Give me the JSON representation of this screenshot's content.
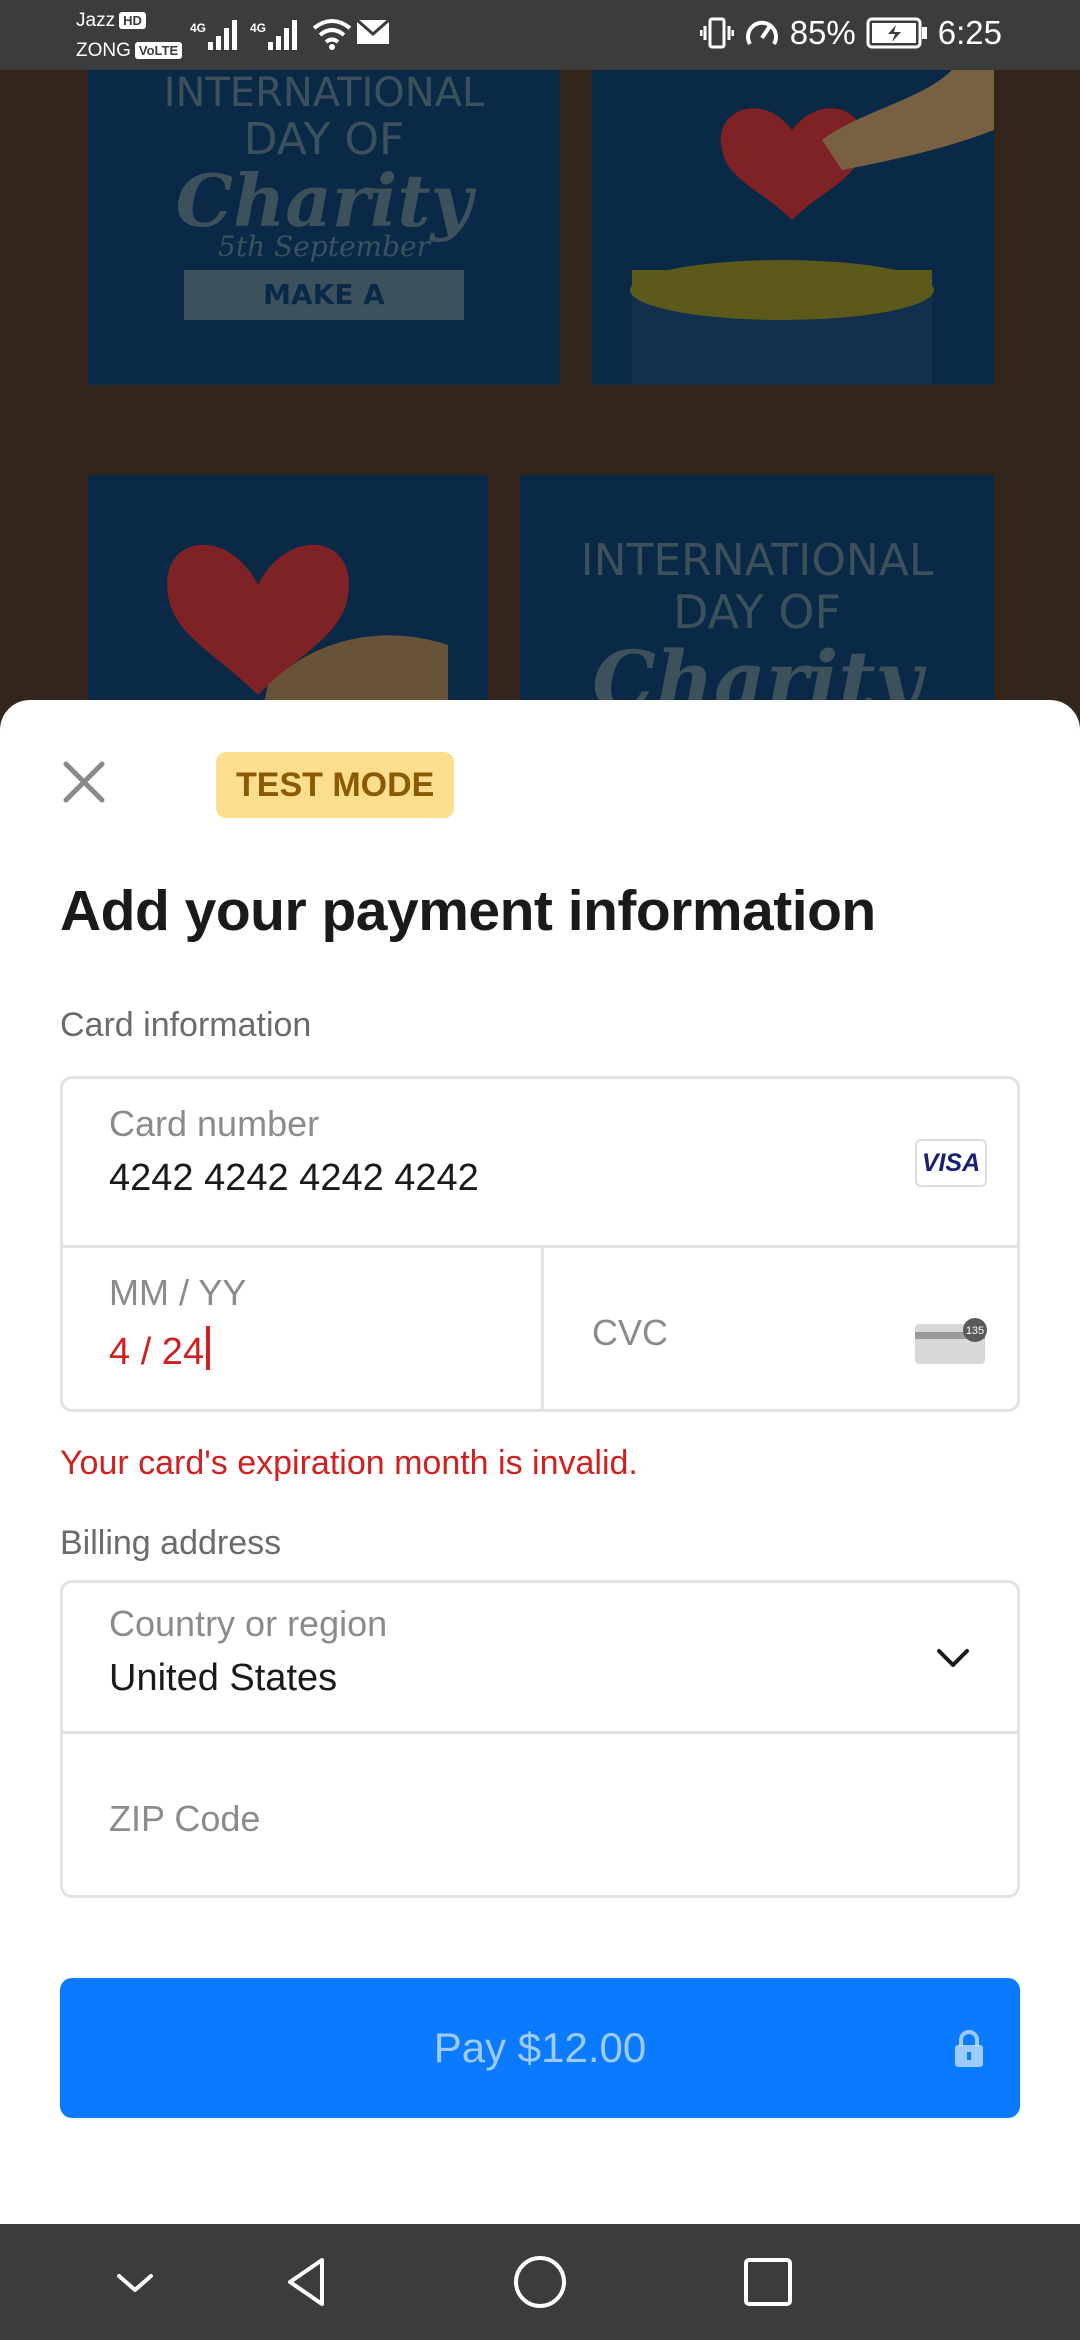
{
  "status_bar": {
    "carrier1": "Jazz",
    "carrier1_tag": "HD",
    "carrier2": "ZONG",
    "carrier2_tag": "VoLTE",
    "network": "4G",
    "battery": "85%",
    "time": "6:25"
  },
  "background": {
    "poster1_line1": "INTERNATIONAL",
    "poster1_line2": "DAY OF",
    "poster1_line3": "Charity",
    "poster1_date": "5th September",
    "poster1_banner": "MAKE A DONATION",
    "poster2_line1": "INTERNATIONAL",
    "poster2_line2": "DAY OF",
    "poster2_line3": "Charity"
  },
  "sheet": {
    "badge": "TEST MODE",
    "title": "Add your payment information",
    "card_section_label": "Card information",
    "card_number_label": "Card number",
    "card_number_value": "4242 4242 4242 4242",
    "card_brand": "VISA",
    "expiry_label": "MM / YY",
    "expiry_value": "4 / 24",
    "cvc_label": "CVC",
    "cvc_hint": "135",
    "error_message": "Your card's expiration month is invalid.",
    "billing_label": "Billing address",
    "country_label": "Country or region",
    "country_value": "United States",
    "zip_label": "ZIP Code",
    "pay_label": "Pay $12.00"
  },
  "colors": {
    "accent": "#0a7aff",
    "error": "#d21f1f",
    "badge_bg": "#fddd8e",
    "badge_text": "#8a5a00"
  },
  "icons": [
    "close-icon",
    "visa-icon",
    "cvc-card-icon",
    "chevron-down-icon",
    "lock-icon",
    "nav-down-icon",
    "nav-back-icon",
    "nav-home-icon",
    "nav-recents-icon"
  ]
}
